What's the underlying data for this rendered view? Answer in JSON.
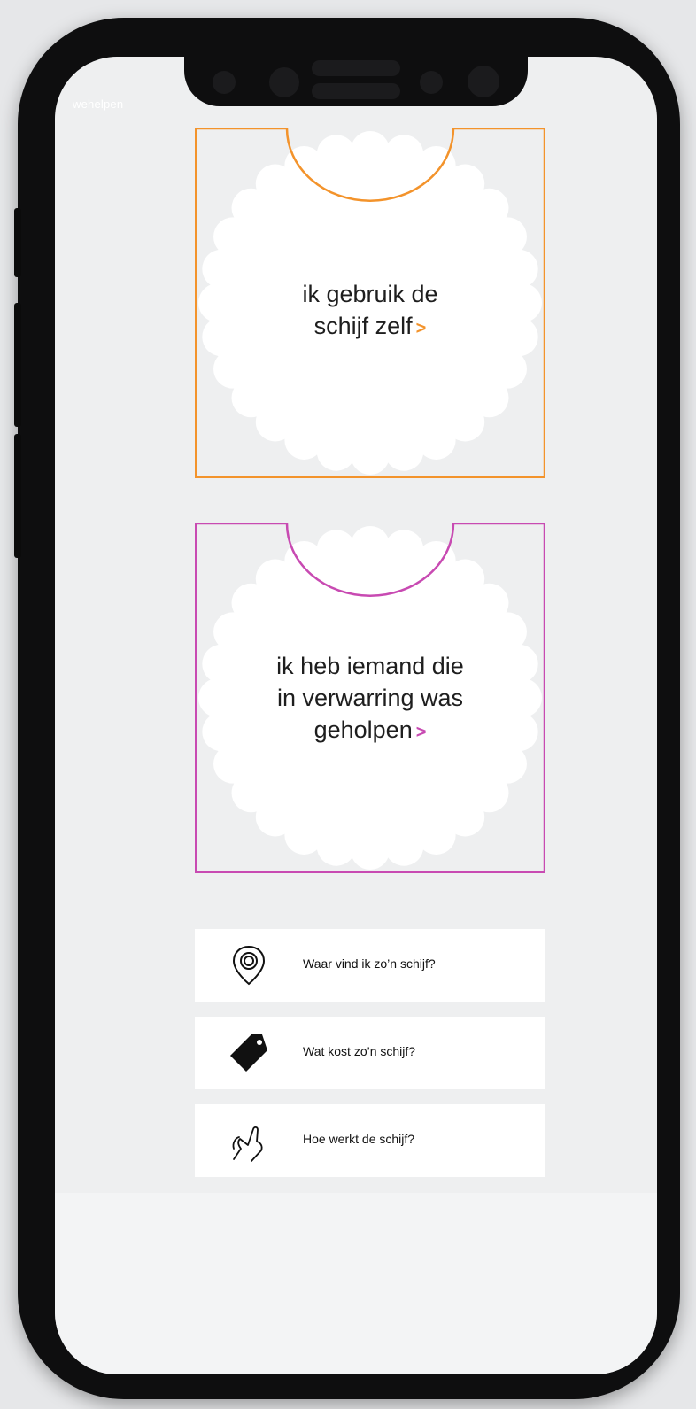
{
  "app": {
    "brand": "wehelpen"
  },
  "options": [
    {
      "lines": [
        "ik gebruik de",
        "schijf zelf"
      ],
      "accent": "#f3932b"
    },
    {
      "lines": [
        "ik heb iemand die",
        "in verwarring was",
        "geholpen"
      ],
      "accent": "#c84ab2"
    }
  ],
  "links": [
    {
      "label": "Waar vind ik zo’n schijf?",
      "icon": "location-pin-icon"
    },
    {
      "label": "Wat kost zo’n schijf?",
      "icon": "price-tag-icon"
    },
    {
      "label": "Hoe werkt de schijf?",
      "icon": "hand-pointer-icon"
    }
  ],
  "chevron": ">"
}
